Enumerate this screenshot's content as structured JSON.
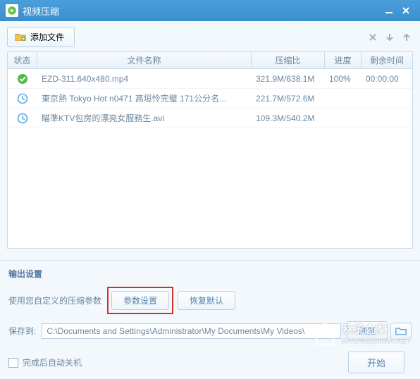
{
  "titlebar": {
    "title": "视频压缩"
  },
  "toolbar": {
    "add_file": "添加文件"
  },
  "table": {
    "headers": {
      "status": "状态",
      "name": "文件名称",
      "ratio": "压缩比",
      "progress": "进度",
      "time": "剩余时间"
    },
    "rows": [
      {
        "status": "done",
        "name": "EZD-311.640x480.mp4",
        "ratio": "321.9M/638.1M",
        "progress": "100%",
        "time": "00:00:00"
      },
      {
        "status": "pending",
        "name": "東京熱 Tokyo Hot n0471 高垣怜完璧 171公分名...",
        "ratio": "221.7M/572.6M",
        "progress": "",
        "time": ""
      },
      {
        "status": "pending",
        "name": "瞄準KTV包房的漂亮女服務生.avi",
        "ratio": "109.3M/540.2M",
        "progress": "",
        "time": ""
      }
    ]
  },
  "output": {
    "section_title": "输出设置",
    "custom_label": "使用您自定义的压缩参数",
    "params_btn": "参数设置",
    "restore_btn": "恢复默认",
    "save_to_label": "保存到:",
    "save_path": "C:\\Documents and Settings\\Administrator\\My Documents\\My Videos\\",
    "browse_btn": "浏览"
  },
  "bottom": {
    "shutdown_label": "完成后自动关机",
    "start_btn": "开始"
  },
  "watermark": {
    "line1": "系统之家",
    "line2": "XITONGZHIJIA.NET"
  }
}
